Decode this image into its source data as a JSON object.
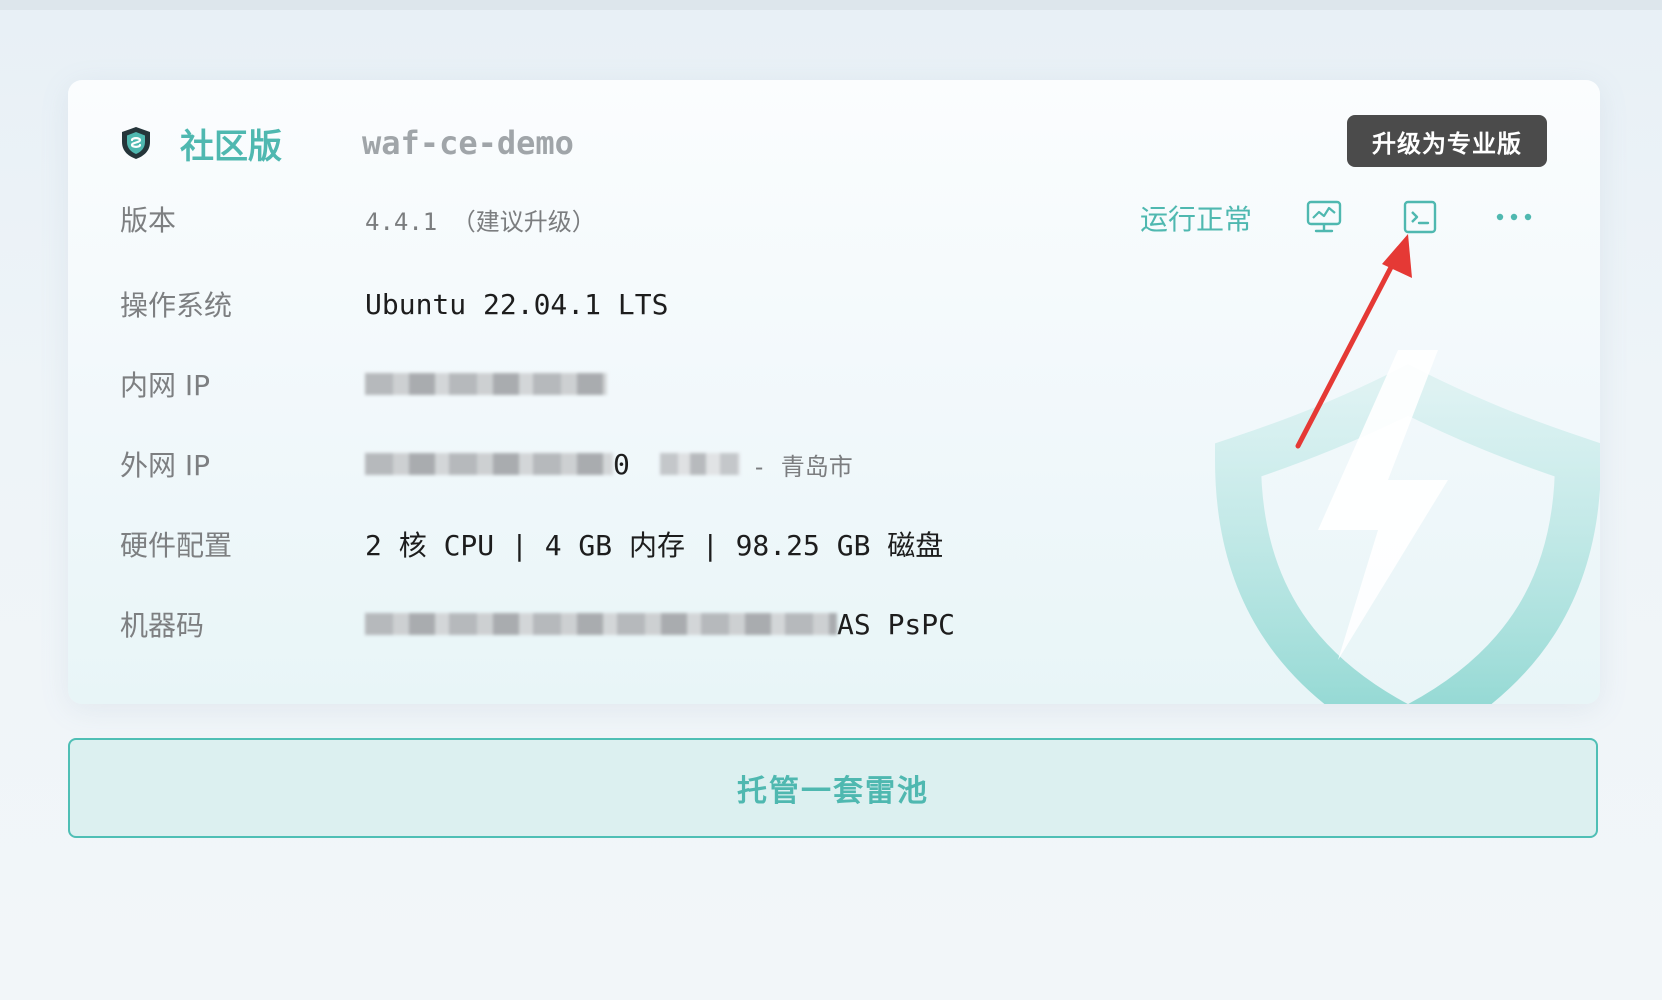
{
  "card": {
    "edition": "社区版",
    "hostname": "waf-ce-demo",
    "upgrade_label": "升级为专业版",
    "status": "运行正常",
    "rows": [
      {
        "label": "版本",
        "value": "4.4.1 （建议升级）"
      },
      {
        "label": "操作系统",
        "value": "Ubuntu 22.04.1 LTS"
      },
      {
        "label": "内网 IP",
        "value": ""
      },
      {
        "label": "外网 IP",
        "value_suffix": "0",
        "location": "- 青岛市"
      },
      {
        "label": "硬件配置",
        "value": "2 核 CPU | 4 GB 内存 | 98.25 GB 磁盘"
      },
      {
        "label": "机器码",
        "value_suffix": "AS PsPC"
      }
    ],
    "icons": {
      "monitor": "monitor-chart-icon",
      "terminal": "terminal-icon",
      "more": "more-icon",
      "edition": "shield-icon"
    },
    "accent_color": "#4fb8b0"
  },
  "host_button": {
    "label": "托管一套雷池"
  }
}
